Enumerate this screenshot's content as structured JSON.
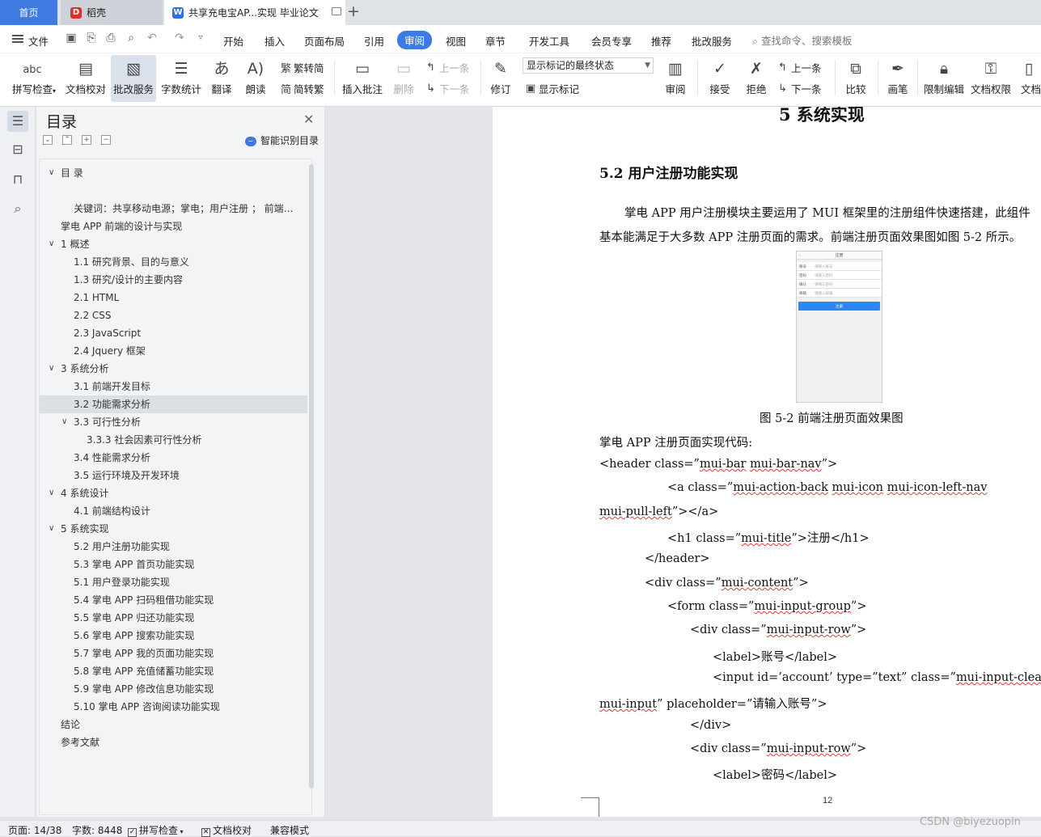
{
  "tabs": {
    "home": "首页",
    "daoke": "稻壳",
    "doc": "共享充电宝AP...实现 毕业论文"
  },
  "menu": {
    "file": "文件",
    "items": [
      "开始",
      "插入",
      "页面布局",
      "引用",
      "审阅",
      "视图",
      "章节",
      "开发工具",
      "会员专享",
      "推荐",
      "批改服务"
    ],
    "active": "审阅",
    "search": "查找命令、搜索模板"
  },
  "ribbon": {
    "spell": "拼写检查",
    "doccheck": "文档校对",
    "correct": "批改服务",
    "wordcount": "字数统计",
    "translate": "翻译",
    "read": "朗读",
    "to_trad": "繁转简",
    "to_simp": "简转繁",
    "insert_comment": "插入批注",
    "delete": "删除",
    "prev_comment": "上一条",
    "next_comment": "下一条",
    "revise": "修订",
    "markup_state": "显示标记的最终状态",
    "show_markup": "显示标记",
    "review": "审阅",
    "accept": "接受",
    "reject": "拒绝",
    "prev_change": "上一条",
    "next_change": "下一条",
    "compare": "比较",
    "ink": "画笔",
    "restrict": "限制编辑",
    "permission": "文档权限",
    "more": "文档"
  },
  "nav": {
    "title": "目录",
    "smart": "智能识别目录",
    "items": [
      {
        "text": "目 录",
        "level": 0,
        "caret": "v"
      },
      {
        "text": "",
        "level": 1
      },
      {
        "text": "关键词：共享移动电源；掌电；用户注册 ； 前端开发；目录",
        "level": 1
      },
      {
        "text": "掌电 APP 前端的设计与实现",
        "level": 0
      },
      {
        "text": "1  概述",
        "level": 0,
        "caret": "v"
      },
      {
        "text": "1.1  研究背景、目的与意义",
        "level": 1
      },
      {
        "text": "1.3  研究/设计的主要内容",
        "level": 1
      },
      {
        "text": "2.1 HTML",
        "level": 1
      },
      {
        "text": "2.2 CSS",
        "level": 1
      },
      {
        "text": "2.3 JavaScript",
        "level": 1
      },
      {
        "text": "2.4 Jquery 框架",
        "level": 1
      },
      {
        "text": "3  系统分析",
        "level": 0,
        "caret": "v"
      },
      {
        "text": "3.1  前端开发目标",
        "level": 1
      },
      {
        "text": "3.2  功能需求分析",
        "level": 1,
        "selected": true
      },
      {
        "text": "3.3  可行性分析",
        "level": 1,
        "caret": "v"
      },
      {
        "text": "3.3.3  社会因素可行性分析",
        "level": 2
      },
      {
        "text": "3.4  性能需求分析",
        "level": 1
      },
      {
        "text": "3.5  运行环境及开发环境",
        "level": 1
      },
      {
        "text": "4  系统设计",
        "level": 0,
        "caret": "v"
      },
      {
        "text": "4.1  前端结构设计",
        "level": 1
      },
      {
        "text": "5  系统实现",
        "level": 0,
        "caret": "v"
      },
      {
        "text": "5.2  用户注册功能实现",
        "level": 1
      },
      {
        "text": "5.3  掌电 APP 首页功能实现",
        "level": 1
      },
      {
        "text": "5.1 用户登录功能实现",
        "level": 1
      },
      {
        "text": "5.4  掌电 APP 扫码租借功能实现",
        "level": 1
      },
      {
        "text": "5.5  掌电 APP 归还功能实现",
        "level": 1
      },
      {
        "text": "5.6  掌电 APP 搜索功能实现",
        "level": 1
      },
      {
        "text": "5.7  掌电 APP 我的页面功能实现",
        "level": 1
      },
      {
        "text": "5.8  掌电 APP 充值储蓄功能实现",
        "level": 1
      },
      {
        "text": "5.9  掌电 APP 修改信息功能实现",
        "level": 1
      },
      {
        "text": "5.10  掌电 APP 咨询阅读功能实现",
        "level": 1
      },
      {
        "text": "结论",
        "level": 0
      },
      {
        "text": "参考文献",
        "level": 0
      }
    ]
  },
  "doc": {
    "chapter": "5  系统实现",
    "section": "5.2 用户注册功能实现",
    "para1": "掌电 APP 用户注册模块主要运用了 MUI 框架里的注册组件快速搭建，此组件",
    "para2": "基本能满足于大多数 APP 注册页面的需求。前端注册页面效果图如图 5-2 所示。",
    "figure": {
      "header": "注册",
      "rows": [
        {
          "label": "账号",
          "ph": "请输入账号"
        },
        {
          "label": "密码",
          "ph": "请输入密码"
        },
        {
          "label": "确认",
          "ph": "请确认密码"
        },
        {
          "label": "邮箱",
          "ph": "请输入邮箱"
        }
      ],
      "button": "注册"
    },
    "caption": "图 5-2  前端注册页面效果图",
    "code_intro": "掌电 APP 注册页面实现代码:",
    "page_number": "12"
  },
  "status": {
    "page": "页面: 14/38",
    "words": "字数: 8448",
    "spell": "拼写检查",
    "doccheck": "文档校对",
    "compat": "兼容模式"
  },
  "watermark": "CSDN @biyezuopin"
}
